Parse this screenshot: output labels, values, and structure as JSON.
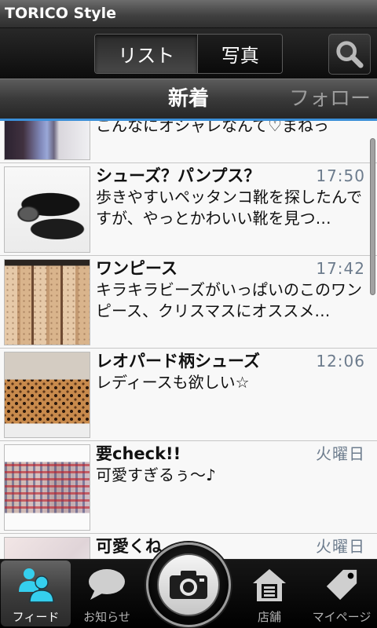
{
  "app": {
    "title": "TORICO Style"
  },
  "toolbar": {
    "segments": [
      {
        "label": "リスト",
        "selected": true
      },
      {
        "label": "写真",
        "selected": false
      }
    ],
    "search_icon": "search-icon"
  },
  "tabs": [
    {
      "label": "新着",
      "active": true
    },
    {
      "label": "フォロー",
      "active": false
    }
  ],
  "feed": {
    "partial_top_item": {
      "body": "こんなにオシャレなんて♡まねっ"
    },
    "items": [
      {
        "title": "シューズ？パンプス？",
        "time": "17:50",
        "body": "歩きやすいペッタンコ靴を探したんですが、やっとかわいい靴を見つ…"
      },
      {
        "title": "ワンピース",
        "time": "17:42",
        "body": "キラキラビーズがいっぱいのこのワンピース、クリスマスにオススメ…"
      },
      {
        "title": "レオパード柄シューズ",
        "time": "12:06",
        "body": "レディースも欲しい☆"
      },
      {
        "title": "要check!!",
        "time": "火曜日",
        "body": "可愛すぎるぅ〜♪"
      },
      {
        "title": "可愛くね",
        "time": "火曜日"
      }
    ]
  },
  "bottom_nav": {
    "items": [
      {
        "label": "フィード",
        "icon": "people-icon",
        "selected": true
      },
      {
        "label": "お知らせ",
        "icon": "speech-bubble-icon",
        "selected": false
      },
      {
        "label": "店舗",
        "icon": "store-icon",
        "selected": false
      },
      {
        "label": "マイページ",
        "icon": "tag-icon",
        "selected": false
      }
    ],
    "camera_icon": "camera-icon"
  },
  "colors": {
    "accent-line": "#3b8fd8",
    "timestamp": "#6d7c8d",
    "feed-icon": "#35cfee",
    "nav-icon": "#cfcfcf"
  }
}
